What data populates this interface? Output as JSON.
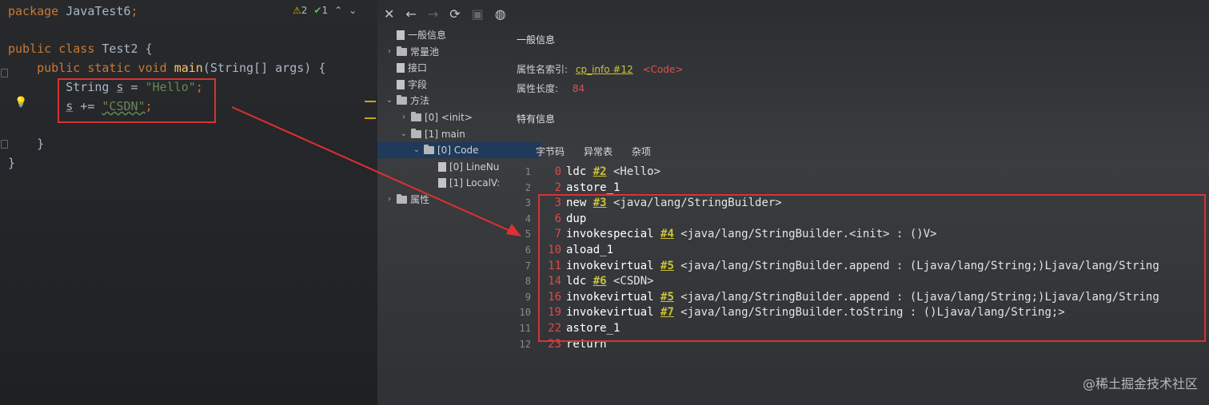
{
  "editor": {
    "lines": [
      {
        "parts": [
          {
            "t": "package ",
            "c": "kw"
          },
          {
            "t": "JavaTest6",
            "c": ""
          },
          {
            "t": ";",
            "c": "kw"
          }
        ]
      },
      {
        "parts": [
          {
            "t": "public class ",
            "c": "kw"
          },
          {
            "t": "Test2 {",
            "c": ""
          }
        ]
      },
      {
        "parts": [
          {
            "t": "    public static void ",
            "c": "kw"
          },
          {
            "t": "main",
            "c": "fn"
          },
          {
            "t": "(String[] args) {",
            "c": ""
          }
        ]
      },
      {
        "parts": [
          {
            "t": "        String ",
            "c": ""
          },
          {
            "t": "s",
            "c": "lv"
          },
          {
            "t": " = ",
            "c": ""
          },
          {
            "t": "\"Hello\"",
            "c": "str"
          },
          {
            "t": ";",
            "c": "kw"
          }
        ]
      },
      {
        "parts": [
          {
            "t": "        ",
            "c": ""
          },
          {
            "t": "s",
            "c": "lv"
          },
          {
            "t": " += ",
            "c": ""
          },
          {
            "t": "\"CSDN\"",
            "c": "str wavy"
          },
          {
            "t": ";",
            "c": "kw"
          }
        ]
      },
      {
        "parts": [
          {
            "t": "    }",
            "c": ""
          }
        ]
      },
      {
        "parts": [
          {
            "t": "}",
            "c": ""
          }
        ]
      }
    ],
    "warnings_count": "2",
    "checks_count": "1"
  },
  "viewer": {
    "toolbar_icons": [
      "close-icon",
      "back-icon",
      "forward-icon",
      "refresh-icon",
      "save-icon",
      "globe-icon"
    ],
    "tree": [
      {
        "label": "一般信息",
        "depth": 0,
        "chev": "",
        "icon": "file",
        "sel": false
      },
      {
        "label": "常量池",
        "depth": 0,
        "chev": "›",
        "icon": "folder",
        "sel": false
      },
      {
        "label": "接口",
        "depth": 0,
        "chev": "",
        "icon": "file",
        "sel": false
      },
      {
        "label": "字段",
        "depth": 0,
        "chev": "",
        "icon": "file",
        "sel": false
      },
      {
        "label": "方法",
        "depth": 0,
        "chev": "⌄",
        "icon": "folder",
        "sel": false
      },
      {
        "label": "[0] <init>",
        "depth": 1,
        "chev": "›",
        "icon": "folder",
        "sel": false
      },
      {
        "label": "[1] main",
        "depth": 1,
        "chev": "⌄",
        "icon": "folder",
        "sel": false
      },
      {
        "label": "[0] Code",
        "depth": 2,
        "chev": "⌄",
        "icon": "folder",
        "sel": true
      },
      {
        "label": "[0] LineNu",
        "depth": 3,
        "chev": "",
        "icon": "file",
        "sel": false
      },
      {
        "label": "[1] LocalV:",
        "depth": 3,
        "chev": "",
        "icon": "file",
        "sel": false
      },
      {
        "label": "属性",
        "depth": 0,
        "chev": "›",
        "icon": "folder",
        "sel": false
      }
    ],
    "general_title": "一般信息",
    "attr_name_label": "属性名索引:",
    "attr_name_link": "cp_info #12",
    "attr_name_value": "<Code>",
    "attr_len_label": "属性长度:",
    "attr_len_value": "84",
    "specific_title": "特有信息",
    "tabs": [
      "字节码",
      "异常表",
      "杂项"
    ]
  },
  "bytecode": [
    {
      "n": "1",
      "off": "0",
      "op": "ldc ",
      "ref": "#2",
      "rest": " <Hello>"
    },
    {
      "n": "2",
      "off": "2",
      "op": "astore_1",
      "ref": "",
      "rest": ""
    },
    {
      "n": "3",
      "off": "3",
      "op": "new ",
      "ref": "#3",
      "rest": " <java/lang/StringBuilder>"
    },
    {
      "n": "4",
      "off": "6",
      "op": "dup",
      "ref": "",
      "rest": ""
    },
    {
      "n": "5",
      "off": "7",
      "op": "invokespecial ",
      "ref": "#4",
      "rest": " <java/lang/StringBuilder.<init> : ()V>"
    },
    {
      "n": "6",
      "off": "10",
      "op": "aload_1",
      "ref": "",
      "rest": ""
    },
    {
      "n": "7",
      "off": "11",
      "op": "invokevirtual ",
      "ref": "#5",
      "rest": " <java/lang/StringBuilder.append : (Ljava/lang/String;)Ljava/lang/String"
    },
    {
      "n": "8",
      "off": "14",
      "op": "ldc ",
      "ref": "#6",
      "rest": " <CSDN>"
    },
    {
      "n": "9",
      "off": "16",
      "op": "invokevirtual ",
      "ref": "#5",
      "rest": " <java/lang/StringBuilder.append : (Ljava/lang/String;)Ljava/lang/String"
    },
    {
      "n": "10",
      "off": "19",
      "op": "invokevirtual ",
      "ref": "#7",
      "rest": " <java/lang/StringBuilder.toString : ()Ljava/lang/String;>"
    },
    {
      "n": "11",
      "off": "22",
      "op": "astore_1",
      "ref": "",
      "rest": ""
    },
    {
      "n": "12",
      "off": "23",
      "op": "return",
      "ref": "",
      "rest": ""
    }
  ],
  "watermark": "@稀土掘金技术社区",
  "colors": {
    "highlight": "#d63333",
    "keyword": "#cc7832",
    "string": "#6a8759",
    "link": "#c9c338"
  }
}
